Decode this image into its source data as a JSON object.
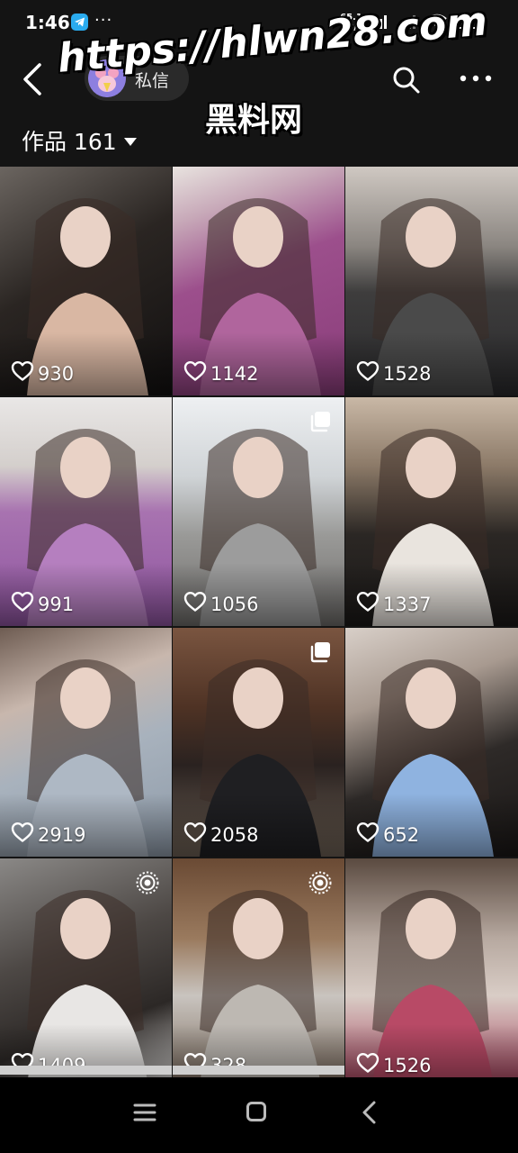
{
  "status_bar": {
    "time": "1:46",
    "more": "···",
    "net_speed_value": "65.1",
    "net_speed_unit": "KB/s",
    "battery": "38"
  },
  "header": {
    "message_label": "私信",
    "works_label": "作品 161"
  },
  "watermark": {
    "url": "https://hlwn28.com",
    "name": "黑料网"
  },
  "tiles": [
    {
      "likes": "930",
      "badge": "",
      "bg": "linear-gradient(150deg,#6b6560 0%,#2a2522 45%,#121010 100%)",
      "accent": "#d9b7a3"
    },
    {
      "likes": "1142",
      "badge": "",
      "bg": "linear-gradient(160deg,#e8e3df 0%,#c7a8b8 20%,#9c4f8c 45%,#8a3d7a 100%)",
      "accent": "#b0659d"
    },
    {
      "likes": "1528",
      "badge": "",
      "bg": "linear-gradient(180deg,#cfc8c2 0%,#8a8580 35%,#3e3d3d 55%,#2a2a2c 100%)",
      "accent": "#4a4a4a"
    },
    {
      "likes": "991",
      "badge": "",
      "bg": "linear-gradient(180deg,#e9e7e6 0%,#d4cfcc 30%,#a873b0 50%,#8f55a0 100%)",
      "accent": "#b57fbf"
    },
    {
      "likes": "1056",
      "badge": "stack",
      "bg": "linear-gradient(180deg,#eef0f2 0%,#cfd3d6 35%,#9a9a98 60%,#6e6c6a 100%)",
      "accent": "#9c9c9c"
    },
    {
      "likes": "1337",
      "badge": "",
      "bg": "linear-gradient(180deg,#c9b8a6 0%,#8c7a68 30%,#2b2724 60%,#1b1918 100%)",
      "accent": "#e9e4de"
    },
    {
      "likes": "2919",
      "badge": "",
      "bg": "linear-gradient(160deg,#6e5c52 0%,#c8b7ad 30%,#a8b2bd 55%,#8e9aa8 100%)",
      "accent": "#aeb8c4"
    },
    {
      "likes": "2058",
      "badge": "stack",
      "bg": "linear-gradient(180deg,#7a5540 0%,#4e3224 35%,#2a2220 60%,#6f6256 100%)",
      "accent": "#1f1f22"
    },
    {
      "likes": "652",
      "badge": "",
      "bg": "linear-gradient(160deg,#d8cfc8 0%,#a89a90 30%,#2e2a28 60%,#1a1716 100%)",
      "accent": "#8fb3e0"
    },
    {
      "likes": "1409",
      "badge": "live",
      "bg": "linear-gradient(160deg,#8a8886 0%,#4d4845 40%,#2c2826 70%,#dcdad8 100%)",
      "accent": "#e8e6e4"
    },
    {
      "likes": "328",
      "badge": "live",
      "bg": "linear-gradient(180deg,#6a4a34 0%,#9a7a5e 35%,#c9c4bf 60%,#7a6a5c 100%)",
      "accent": "#bdb8b2"
    },
    {
      "likes": "1526",
      "badge": "",
      "bg": "linear-gradient(180deg,#5a4a40 0%,#b7a9a0 35%,#d9cdc6 60%,#a43e5a 100%)",
      "accent": "#b84a66"
    }
  ]
}
